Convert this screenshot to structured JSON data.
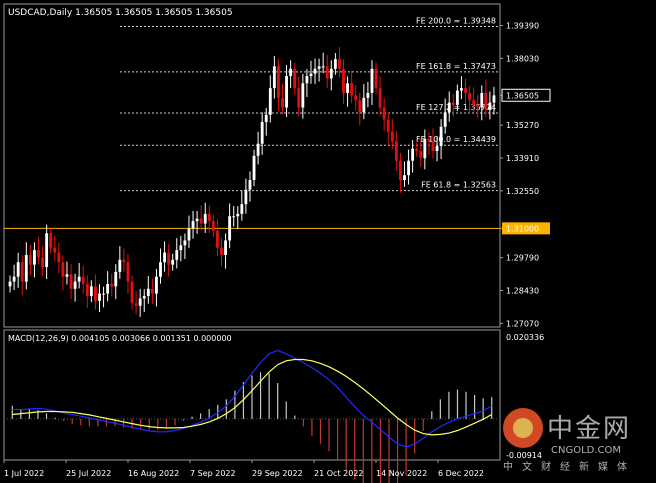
{
  "chart_data": {
    "type": "candlestick",
    "symbol_header": "USDCAD,Daily  1.36505 1.36505 1.36505 1.36505",
    "price_axis": [
      "1.39390",
      "1.38030",
      "1.36505",
      "1.35270",
      "1.33910",
      "1.32550",
      "1.31000",
      "1.29790",
      "1.28430",
      "1.27070"
    ],
    "price_range": [
      1.2692,
      1.4028
    ],
    "current_price": "1.36505",
    "level_line": {
      "label": "1.31000",
      "value": 1.31,
      "color": "#ffb300"
    },
    "fib_levels": [
      {
        "label": "FE 200.0 = 1.39348",
        "value": 1.39348
      },
      {
        "label": "FE 161.8 = 1.37473",
        "value": 1.37473
      },
      {
        "label": "FE 127.2 = 1.35774",
        "value": 1.35774
      },
      {
        "label": "FE 100.0 = 1.34439",
        "value": 1.34439
      },
      {
        "label": "FE 61.8 = 1.32563",
        "value": 1.32563
      }
    ],
    "date_labels": [
      "1 Jul 2022",
      "25 Jul 2022",
      "16 Aug 2022",
      "7 Sep 2022",
      "29 Sep 2022",
      "21 Oct 2022",
      "14 Nov 2022",
      "6 Dec 2022"
    ],
    "closes": [
      1.288,
      1.29,
      1.296,
      1.288,
      1.299,
      1.295,
      1.301,
      1.298,
      1.294,
      1.308,
      1.302,
      1.3,
      1.296,
      1.29,
      1.291,
      1.285,
      1.288,
      1.29,
      1.287,
      1.282,
      1.286,
      1.28,
      1.283,
      1.283,
      1.287,
      1.286,
      1.292,
      1.297,
      1.296,
      1.288,
      1.279,
      1.278,
      1.281,
      1.282,
      1.285,
      1.283,
      1.29,
      1.296,
      1.3,
      1.295,
      1.297,
      1.301,
      1.303,
      1.305,
      1.31,
      1.313,
      1.314,
      1.312,
      1.316,
      1.313,
      1.309,
      1.302,
      1.299,
      1.305,
      1.315,
      1.315,
      1.316,
      1.32,
      1.326,
      1.33,
      1.34,
      1.345,
      1.354,
      1.357,
      1.368,
      1.377,
      1.364,
      1.36,
      1.373,
      1.376,
      1.368,
      1.36,
      1.37,
      1.373,
      1.374,
      1.376,
      1.377,
      1.377,
      1.372,
      1.376,
      1.38,
      1.376,
      1.366,
      1.37,
      1.365,
      1.363,
      1.358,
      1.364,
      1.366,
      1.376,
      1.368,
      1.36,
      1.355,
      1.35,
      1.346,
      1.338,
      1.33,
      1.332,
      1.338,
      1.343,
      1.342,
      1.339,
      1.347,
      1.346,
      1.342,
      1.344,
      1.352,
      1.358,
      1.362,
      1.361,
      1.367,
      1.368,
      1.366,
      1.363,
      1.361,
      1.36,
      1.366,
      1.359,
      1.362,
      1.365
    ],
    "macd_label": "MACD(12,26,9) 0.004105 0.003066 0.001351 0.000000",
    "macd_axis": {
      "top": "0.020336",
      "bottom": "-0.00914"
    },
    "macd_range": [
      -0.0095,
      0.0205
    ],
    "macd_main": [
      0.0022,
      0.0021,
      0.0023,
      0.0024,
      0.0022,
      0.0018,
      0.0014,
      0.001,
      0.0006,
      0.0002,
      -0.0002,
      -0.0006,
      -0.001,
      -0.0015,
      -0.002,
      -0.0024,
      -0.0028,
      -0.003,
      -0.003,
      -0.0027,
      -0.0022,
      -0.0015,
      -0.0008,
      0.0002,
      0.0014,
      0.003,
      0.0052,
      0.0078,
      0.0105,
      0.013,
      0.015,
      0.0158,
      0.015,
      0.014,
      0.013,
      0.0118,
      0.0105,
      0.009,
      0.0072,
      0.005,
      0.0028,
      0.0008,
      -0.0008,
      -0.0025,
      -0.0042,
      -0.0058,
      -0.0065,
      -0.0058,
      -0.0045,
      -0.003,
      -0.0018,
      -0.0008,
      0.0,
      0.0006,
      0.0012,
      0.0018,
      0.003
    ],
    "macd_signal": [
      0.001,
      0.0012,
      0.0014,
      0.0016,
      0.0017,
      0.0017,
      0.0016,
      0.0015,
      0.0012,
      0.0009,
      0.0005,
      0.0001,
      -0.0003,
      -0.0007,
      -0.0011,
      -0.0015,
      -0.0018,
      -0.002,
      -0.0021,
      -0.0021,
      -0.002,
      -0.0017,
      -0.0013,
      -0.0007,
      0.0001,
      0.0012,
      0.0026,
      0.0044,
      0.0065,
      0.0087,
      0.0108,
      0.0125,
      0.0134,
      0.0137,
      0.0137,
      0.0134,
      0.0128,
      0.012,
      0.011,
      0.0098,
      0.0084,
      0.0069,
      0.0053,
      0.0036,
      0.0019,
      0.0002,
      -0.0013,
      -0.0026,
      -0.0034,
      -0.0037,
      -0.0036,
      -0.0033,
      -0.0027,
      -0.0019,
      -0.001,
      -0.0001,
      0.001
    ],
    "macd_main_color": "#1f2bff",
    "macd_signal_color": "#ffff66",
    "hist_pos_color": "#c8c8c8",
    "hist_neg_color": "#c0392b",
    "bull_color": "#ffffff",
    "bear_color": "#e01010"
  },
  "watermark": {
    "cn_text": "中金网",
    "domain": "CNGOLD.COM",
    "tag": "中文财经新媒体"
  }
}
